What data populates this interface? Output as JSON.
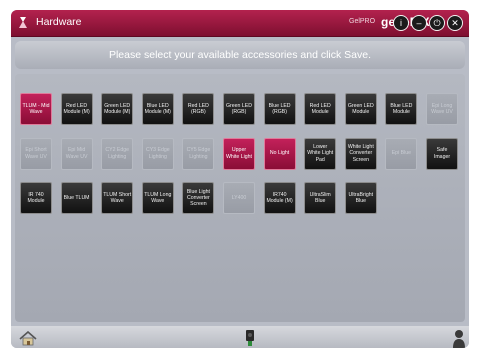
{
  "window": {
    "title": "Hardware",
    "brand_small": "GelPRO",
    "brand": "genePIX"
  },
  "window_buttons": [
    {
      "icon": "info-icon",
      "glyph": "i"
    },
    {
      "icon": "minimize-icon",
      "glyph": "–"
    },
    {
      "icon": "power-icon",
      "glyph": "⏻"
    },
    {
      "icon": "close-icon",
      "glyph": "✕"
    }
  ],
  "instruction": "Please select your available accessories and click Save.",
  "tiles": [
    {
      "label": "TLUM - Mid Wave",
      "state": "selected"
    },
    {
      "label": "Red LED Module (M)",
      "state": "available"
    },
    {
      "label": "Green LED Module (M)",
      "state": "available"
    },
    {
      "label": "Blue LED Module (M)",
      "state": "available"
    },
    {
      "label": "Red LED (RGB)",
      "state": "available"
    },
    {
      "label": "Green LED (RGB)",
      "state": "available"
    },
    {
      "label": "Blue LED (RGB)",
      "state": "available"
    },
    {
      "label": "Red LED Module",
      "state": "available"
    },
    {
      "label": "Green LED Module",
      "state": "available"
    },
    {
      "label": "Blue LED Module",
      "state": "available"
    },
    {
      "label": "Epi Long Wave UV",
      "state": "disabled"
    },
    {
      "label": "Epi Short Wave UV",
      "state": "disabled"
    },
    {
      "label": "Epi Mid Wave UV",
      "state": "disabled"
    },
    {
      "label": "CY2 Edge Lighting",
      "state": "disabled"
    },
    {
      "label": "CY3 Edge Lighting",
      "state": "disabled"
    },
    {
      "label": "CY5 Edge Lighting",
      "state": "disabled"
    },
    {
      "label": "Upper White Light",
      "state": "selected"
    },
    {
      "label": "No Light",
      "state": "selected"
    },
    {
      "label": "Lower White Light Pad",
      "state": "available"
    },
    {
      "label": "White Light Converter Screen",
      "state": "available"
    },
    {
      "label": "Epi Blue",
      "state": "disabled"
    },
    {
      "label": "Safe Imager",
      "state": "available"
    },
    {
      "label": "IR 740 Module",
      "state": "available"
    },
    {
      "label": "Blue TLUM",
      "state": "available"
    },
    {
      "label": "TLUM Short Wave",
      "state": "available"
    },
    {
      "label": "TLUM Long Wave",
      "state": "available"
    },
    {
      "label": "Blue Light Converter Screen",
      "state": "available"
    },
    {
      "label": "LY400",
      "state": "disabled"
    },
    {
      "label": "IR740 Module (M)",
      "state": "available"
    },
    {
      "label": "UltraSlim Blue",
      "state": "available"
    },
    {
      "label": "UltraBright Blue",
      "state": "available"
    }
  ],
  "footer": {
    "home_icon": "home-icon",
    "camera_icon": "camera-icon",
    "user_icon": "user-icon"
  }
}
